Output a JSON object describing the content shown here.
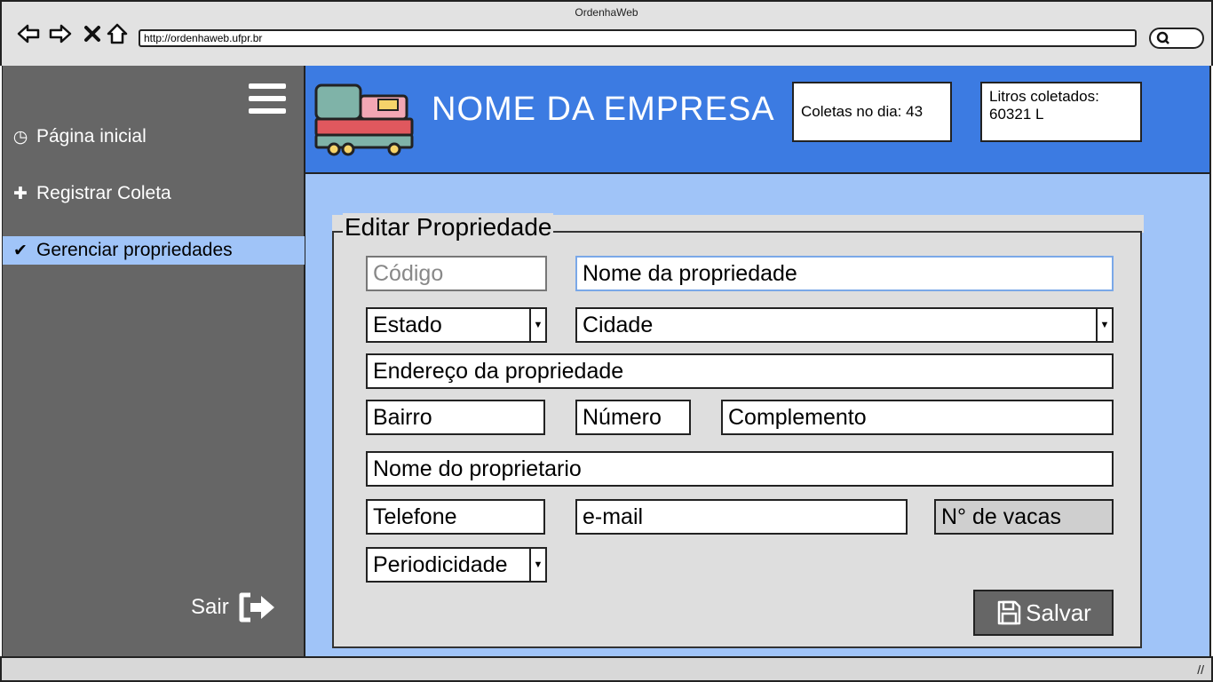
{
  "browser": {
    "title": "OrdenhaWeb",
    "url": "http://ordenhaweb.ufpr.br",
    "nav_icons": [
      "back-arrow-icon",
      "forward-arrow-icon",
      "close-icon",
      "home-icon"
    ],
    "search_icon": "search-icon"
  },
  "sidebar": {
    "menu_icon": "hamburger-menu-icon",
    "items": [
      {
        "label": "Página inicial",
        "icon": "clock-icon",
        "glyph": "◷",
        "active": false
      },
      {
        "label": "Registrar Coleta",
        "icon": "plus-icon",
        "glyph": "✚",
        "active": false
      },
      {
        "label": "Gerenciar propriedades",
        "icon": "check-icon",
        "glyph": "✔",
        "active": true
      }
    ],
    "logout_label": "Sair",
    "logout_icon": "sign-out-icon"
  },
  "header": {
    "company_name": "NOME DA EMPRESA",
    "logo_icon": "truck-icon",
    "stats": {
      "coletas": "Coletas no dia: 43",
      "litros_label": "Litros coletados:",
      "litros_value": "60321 L"
    }
  },
  "form": {
    "title": "Editar Propriedade",
    "fields": {
      "codigo": "Código",
      "nome": "Nome da propriedade",
      "estado": "Estado",
      "cidade": "Cidade",
      "endereco": "Endereço da propriedade",
      "bairro": "Bairro",
      "numero": "Número",
      "complemento": "Complemento",
      "proprietario": "Nome do proprietario",
      "telefone": "Telefone",
      "email": "e-mail",
      "vacas": "N° de vacas",
      "periodicidade": "Periodicidade"
    },
    "save_label": "Salvar",
    "save_icon": "floppy-disk-icon"
  },
  "colors": {
    "header_blue": "#3c7be2",
    "main_light_blue": "#a0c4f8",
    "sidebar_gray": "#666666",
    "form_gray": "#dedede"
  }
}
